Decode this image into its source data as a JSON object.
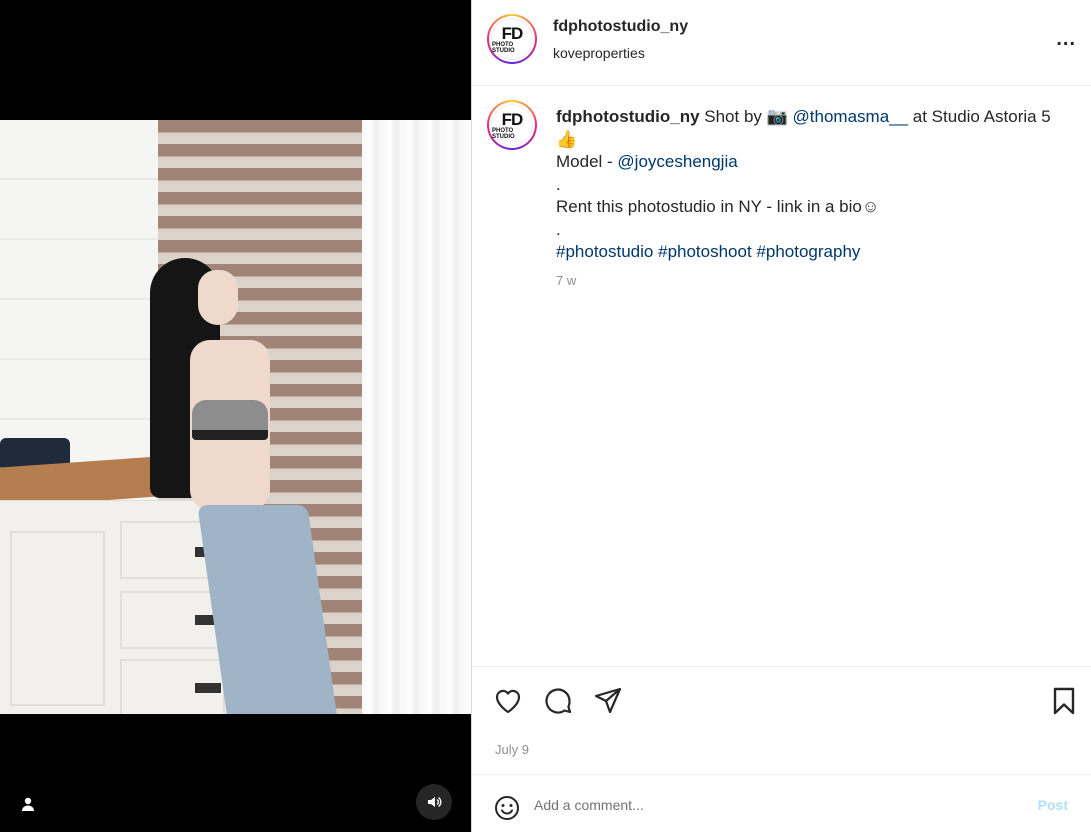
{
  "post": {
    "username": "fdphotostudio_ny",
    "location": "koveproperties",
    "more_label": "...",
    "avatar_logo_main": "FD",
    "avatar_logo_sub": "PHOTO STUDIO"
  },
  "caption": {
    "username": "fdphotostudio_ny",
    "text_1": "Shot by 📷 ",
    "mention_photographer": "@thomasma__",
    "text_2": " at Studio Astoria 5",
    "emoji_thumb": "👍",
    "model_label": "Model - ",
    "mention_model": "@joyceshengjia",
    "dot_1": ".",
    "rent_text": "Rent this photostudio in NY - link in a bio☺",
    "dot_2": ".",
    "hashtag_1": "#photostudio",
    "hashtag_2": "#photoshoot",
    "hashtag_3": "#photography",
    "time_ago": "7 w"
  },
  "actions": {
    "date": "July 9",
    "like_icon": "heart-icon",
    "comment_icon": "comment-icon",
    "share_icon": "paper-plane-icon",
    "save_icon": "bookmark-icon"
  },
  "comment_box": {
    "placeholder": "Add a comment...",
    "post_label": "Post",
    "post_color": "#b2dffc"
  },
  "media": {
    "user_tag_icon": "person-icon",
    "sound_icon": "speaker-icon"
  }
}
